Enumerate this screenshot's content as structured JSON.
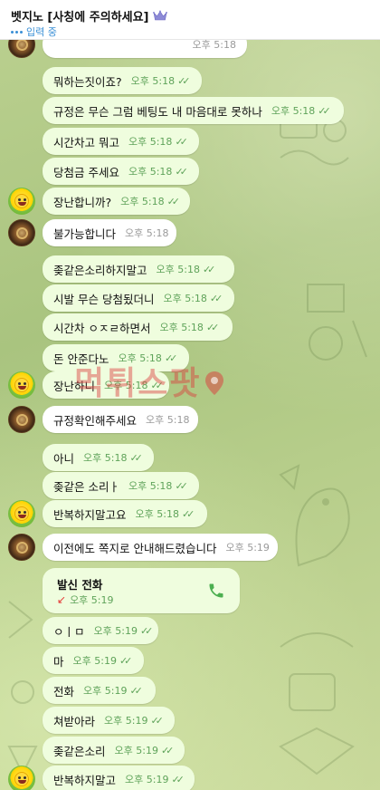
{
  "header": {
    "title": "벳지노 [사칭에 주의하세요]",
    "status": "입력 중"
  },
  "watermark": "먹튀스팟",
  "messages": [
    {
      "text": "",
      "time": "오후 5:18",
      "dir": "in",
      "avatar": "brown"
    },
    {
      "text": "뭐하는짓이죠?",
      "time": "오후 5:18",
      "dir": "out"
    },
    {
      "text": "규정은 무슨 그럼 베팅도 내 마음대로 못하나",
      "time": "오후 5:18",
      "dir": "out"
    },
    {
      "text": "시간차고 뭐고",
      "time": "오후 5:18",
      "dir": "out"
    },
    {
      "text": "당첨금 주세요",
      "time": "오후 5:18",
      "dir": "out"
    },
    {
      "text": "장난합니까?",
      "time": "오후 5:18",
      "dir": "out",
      "avatar": "smile"
    },
    {
      "text": "불가능합니다",
      "time": "오후 5:18",
      "dir": "in",
      "avatar": "brown"
    },
    {
      "text": "좆같은소리하지말고",
      "time": "오후 5:18",
      "dir": "out"
    },
    {
      "text": "시발 무슨 당첨됬더니",
      "time": "오후 5:18",
      "dir": "out"
    },
    {
      "text": "시간차 ㅇㅈㄹ하면서",
      "time": "오후 5:18",
      "dir": "out"
    },
    {
      "text": "돈 안준다노",
      "time": "오후 5:18",
      "dir": "out"
    },
    {
      "text": "장난하니",
      "time": "오후 5:18",
      "dir": "out",
      "avatar": "smile"
    },
    {
      "text": "규정확인해주세요",
      "time": "오후 5:18",
      "dir": "in",
      "avatar": "brown"
    },
    {
      "text": "아니",
      "time": "오후 5:18",
      "dir": "out"
    },
    {
      "text": "좆같은 소리ㅏ",
      "time": "오후 5:18",
      "dir": "out"
    },
    {
      "text": "반복하지말고요",
      "time": "오후 5:18",
      "dir": "out",
      "avatar": "smile"
    },
    {
      "text": "이전에도 쪽지로 안내해드렸습니다",
      "time": "오후 5:19",
      "dir": "in",
      "avatar": "brown"
    },
    {
      "text": "ㅇㅣㅁ",
      "time": "오후 5:19",
      "dir": "out"
    },
    {
      "text": "마",
      "time": "오후 5:19",
      "dir": "out"
    },
    {
      "text": "전화",
      "time": "오후 5:19",
      "dir": "out"
    },
    {
      "text": "쳐받아라",
      "time": "오후 5:19",
      "dir": "out"
    },
    {
      "text": "좆같은소리",
      "time": "오후 5:19",
      "dir": "out"
    },
    {
      "text": "반복하지말고",
      "time": "오후 5:19",
      "dir": "out",
      "avatar": "smile"
    }
  ],
  "call": {
    "title": "발신 전화",
    "time": "오후 5:19"
  },
  "icons": {
    "crown": "crown-icon",
    "typing": "typing-dots-icon",
    "checks": "double-check-icon",
    "phone": "phone-icon",
    "call_arrow": "outgoing-call-arrow-icon"
  },
  "colors": {
    "outgoing_bubble": "#effdde",
    "incoming_bubble": "#ffffff",
    "check_green": "#5fa35a",
    "typing_blue": "#3a8fd6",
    "watermark_red": "#dc3c3c"
  }
}
